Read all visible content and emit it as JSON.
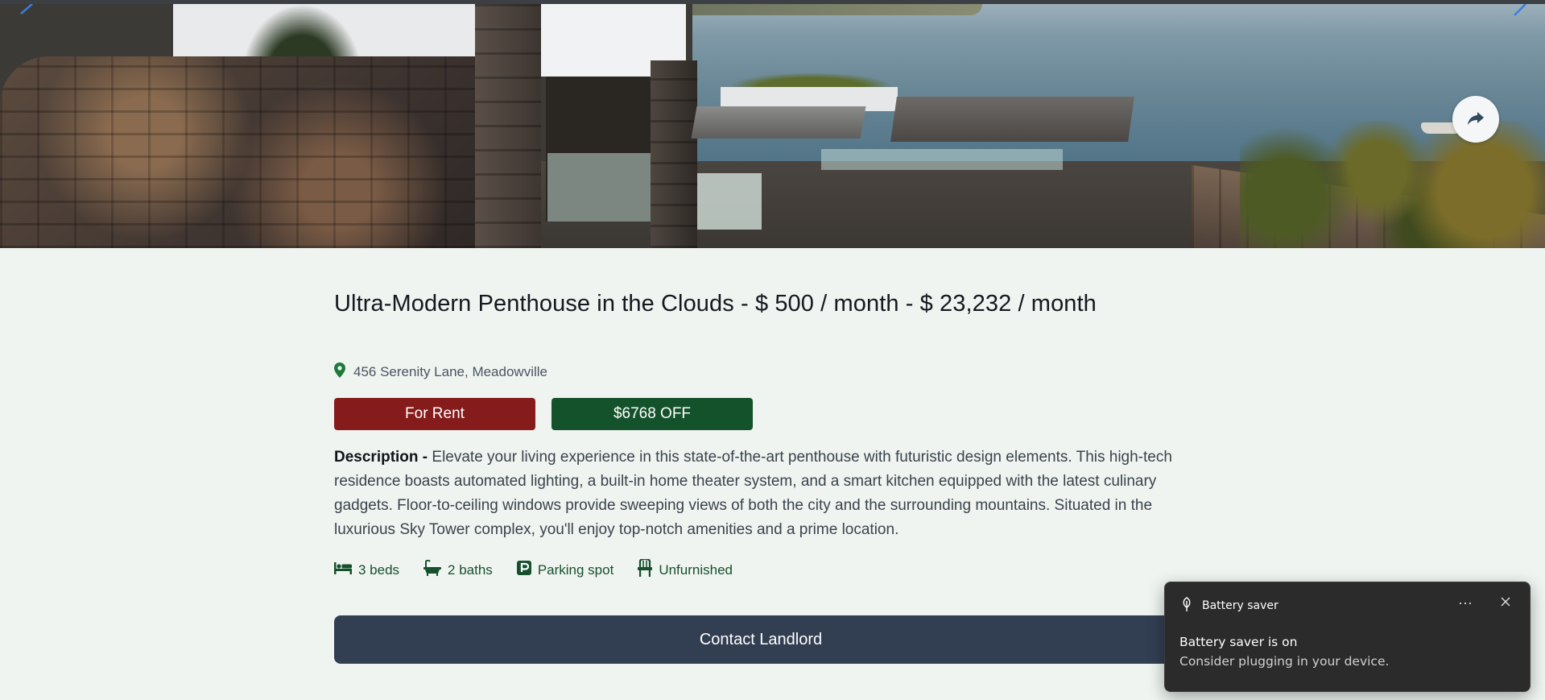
{
  "listing": {
    "title": "Ultra-Modern Penthouse in the Clouds - $ 500 / month - $ 23,232 / month",
    "address": "456 Serenity Lane, Meadowville",
    "status_badge": "For Rent",
    "discount_badge": "$6768 OFF",
    "description_label": "Description - ",
    "description": "Elevate your living experience in this state-of-the-art penthouse with futuristic design elements. This high-tech residence boasts automated lighting, a built-in home theater system, and a smart kitchen equipped with the latest culinary gadgets. Floor-to-ceiling windows provide sweeping views of both the city and the surrounding mountains. Situated in the luxurious Sky Tower complex, you'll enjoy top-notch amenities and a prime location.",
    "features": {
      "beds": "3 beds",
      "baths": "2 baths",
      "parking": "Parking spot",
      "furnishing": "Unfurnished"
    },
    "contact_button": "Contact Landlord"
  },
  "icons": {
    "location": "map-pin-icon",
    "share": "share-arrow-icon",
    "beds": "bed-icon",
    "baths": "bath-icon",
    "parking": "parking-icon",
    "furnishing": "chair-icon"
  },
  "colors": {
    "page_background": "#eff4f0",
    "rent_badge": "#861b1b",
    "discount_badge": "#14522c",
    "feature_text": "#16502c",
    "contact_button": "#323f52",
    "toast_background": "#2b2b2b"
  },
  "toast": {
    "app_name": "Battery saver",
    "title": "Battery saver is on",
    "body": "Consider plugging in your device.",
    "more_label": "···"
  }
}
